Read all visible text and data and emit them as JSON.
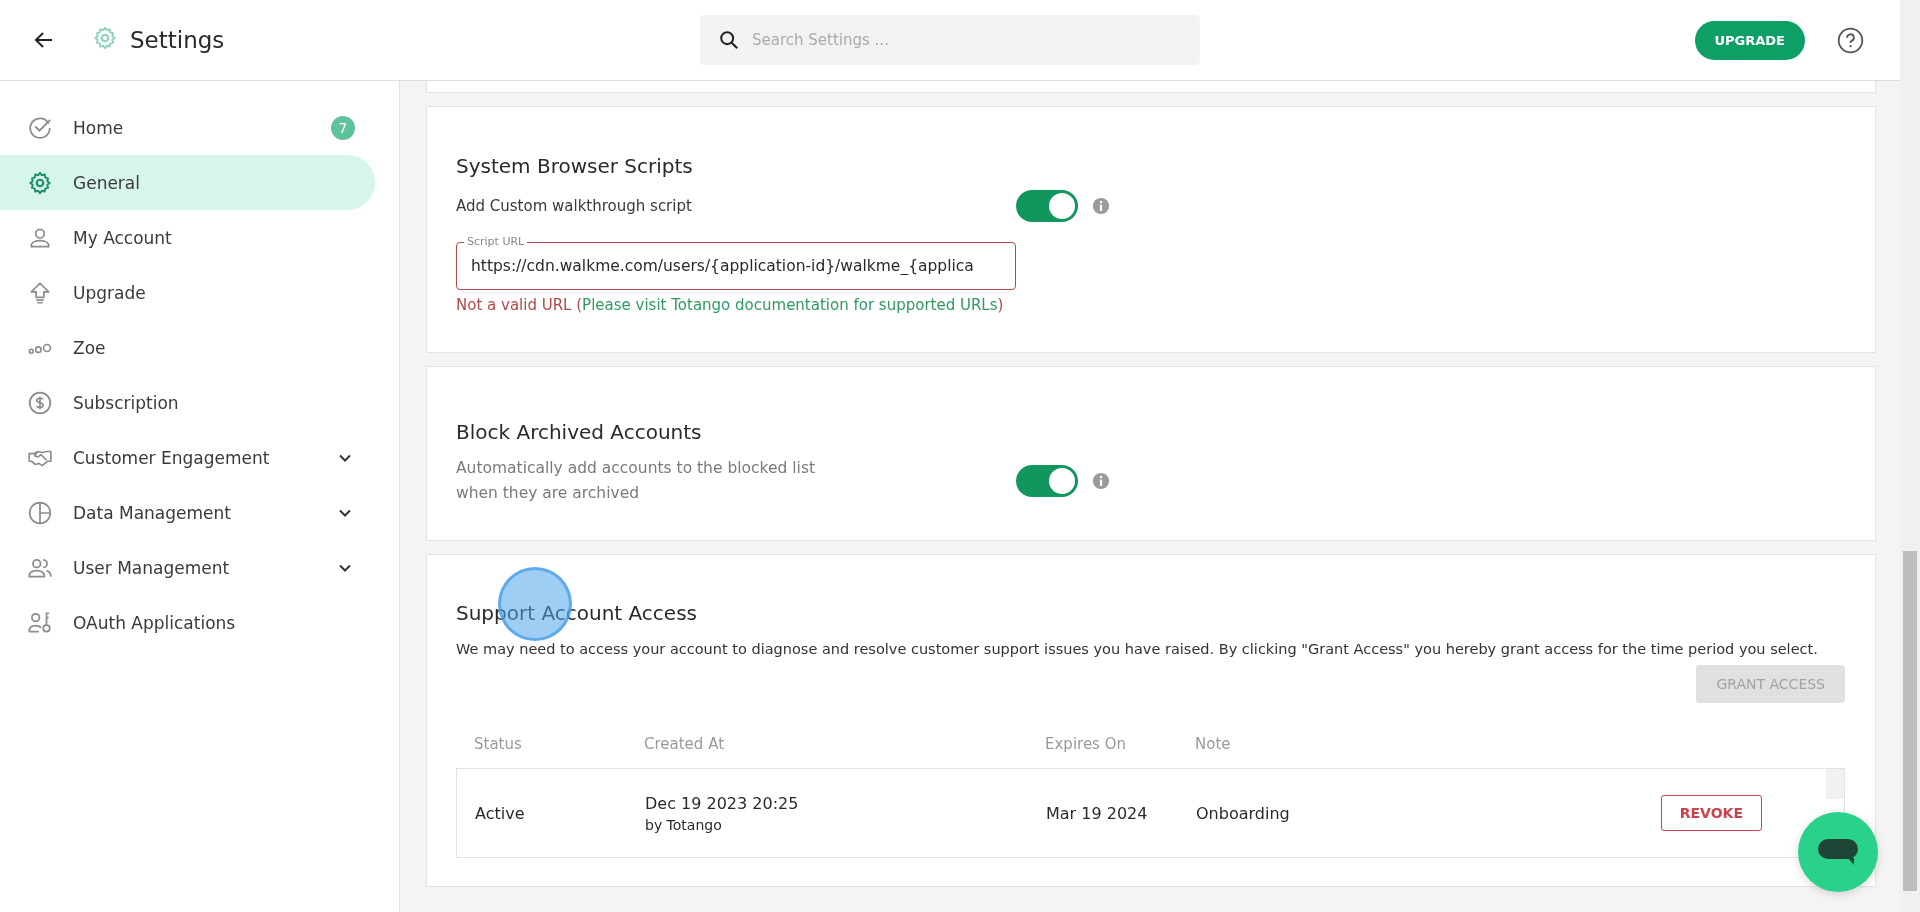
{
  "header": {
    "title": "Settings",
    "search": {
      "placeholder": "Search Settings ..."
    },
    "upgrade_button": "UPGRADE"
  },
  "sidebar": {
    "items": [
      {
        "label": "Home",
        "selected": false,
        "badge": "7",
        "expandable": false
      },
      {
        "label": "General",
        "selected": true,
        "expandable": false
      },
      {
        "label": "My Account",
        "selected": false,
        "expandable": false
      },
      {
        "label": "Upgrade",
        "selected": false,
        "expandable": false
      },
      {
        "label": "Zoe",
        "selected": false,
        "expandable": false
      },
      {
        "label": "Subscription",
        "selected": false,
        "expandable": false
      },
      {
        "label": "Customer Engagement",
        "selected": false,
        "expandable": true
      },
      {
        "label": "Data Management",
        "selected": false,
        "expandable": true
      },
      {
        "label": "User Management",
        "selected": false,
        "expandable": true
      },
      {
        "label": "OAuth Applications",
        "selected": false,
        "expandable": false
      }
    ]
  },
  "scripts_card": {
    "title": "System Browser Scripts",
    "toggle": {
      "label": "Add Custom walkthrough script",
      "on": true
    },
    "field": {
      "label": "Script URL",
      "value": "https://cdn.walkme.com/users/{application-id}/walkme_{applica",
      "invalid": true
    },
    "error": {
      "message": "Not a valid URL",
      "open": "(",
      "link": "Please visit Totango documentation for supported URLs",
      "close": ")"
    }
  },
  "archived_card": {
    "title": "Block Archived Accounts",
    "toggle": {
      "label": "Automatically add accounts to the blocked list when they are archived",
      "on": true
    }
  },
  "support_card": {
    "title": "Support Account Access",
    "description": "We may need to access your account to diagnose and resolve customer support issues you have raised. By clicking \"Grant Access\" you hereby grant access for the time period you select.",
    "grant_button": {
      "label": "GRANT ACCESS",
      "disabled": true
    },
    "table": {
      "columns": [
        "Status",
        "Created At",
        "Expires On",
        "Note"
      ],
      "rows": [
        {
          "status": "Active",
          "created": "Dec 19 2023 20:25",
          "created_by": "by Totango",
          "expires": "Mar 19 2024",
          "note": "Onboarding",
          "action": "REVOKE"
        }
      ]
    }
  }
}
